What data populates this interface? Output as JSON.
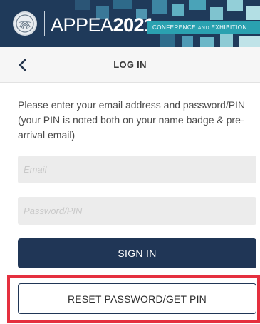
{
  "banner": {
    "brand_light": "APPEA",
    "brand_year": "2021",
    "tagline_a": "CONFERENCE ",
    "tagline_and": "AND ",
    "tagline_b": "EXHIBITION",
    "logo_icon": "appea-shell-logo",
    "colors": {
      "background": "#1f3a5a",
      "accent": "#2aa1b0"
    }
  },
  "navbar": {
    "back_icon": "chevron-left-icon",
    "title": "LOG IN"
  },
  "form": {
    "instructions": "Please enter your email address and password/PIN (your PIN is noted both on your name badge & pre-arrival email)",
    "email_placeholder": "Email",
    "password_placeholder": "Password/PIN",
    "signin_label": "SIGN IN",
    "reset_label": "RESET PASSWORD/GET PIN"
  },
  "colors": {
    "primary": "#203656",
    "highlight": "#e5303f"
  }
}
